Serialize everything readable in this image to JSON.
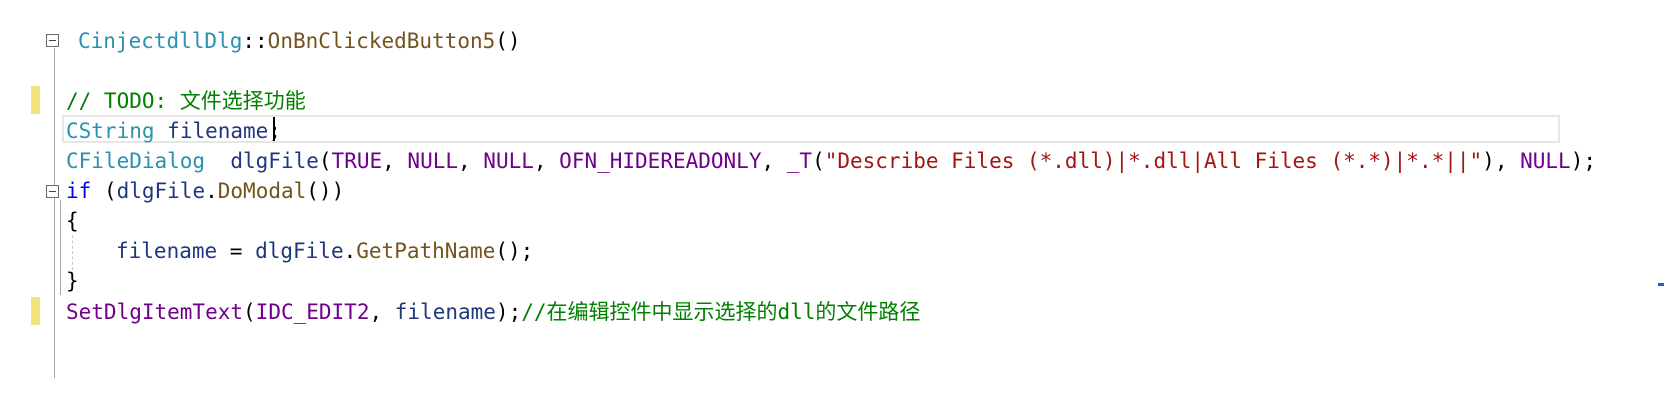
{
  "editor": {
    "lines": [
      {
        "id": "fn-signature",
        "tokens": [
          {
            "cls": "t",
            "text": "CinjectdllDlg"
          },
          {
            "cls": "p",
            "text": "::"
          },
          {
            "cls": "f",
            "text": "OnBnClickedButton5"
          },
          {
            "cls": "p",
            "text": "()"
          }
        ]
      },
      {
        "id": "todo-comment",
        "tokens": [
          {
            "cls": "c",
            "text": "// TODO: 文件选择功能"
          }
        ]
      },
      {
        "id": "filename-decl",
        "tokens": [
          {
            "cls": "t",
            "text": "CString"
          },
          {
            "cls": "p",
            "text": " "
          },
          {
            "cls": "v",
            "text": "filename"
          },
          {
            "cls": "p",
            "text": ";"
          }
        ]
      },
      {
        "id": "filedialog-decl",
        "tokens": [
          {
            "cls": "t",
            "text": "CFileDialog"
          },
          {
            "cls": "p",
            "text": "  "
          },
          {
            "cls": "v",
            "text": "dlgFile"
          },
          {
            "cls": "p",
            "text": "("
          },
          {
            "cls": "m",
            "text": "TRUE"
          },
          {
            "cls": "p",
            "text": ", "
          },
          {
            "cls": "m",
            "text": "NULL"
          },
          {
            "cls": "p",
            "text": ", "
          },
          {
            "cls": "m",
            "text": "NULL"
          },
          {
            "cls": "p",
            "text": ", "
          },
          {
            "cls": "m",
            "text": "OFN_HIDEREADONLY"
          },
          {
            "cls": "p",
            "text": ", "
          },
          {
            "cls": "m",
            "text": "_T"
          },
          {
            "cls": "p",
            "text": "("
          },
          {
            "cls": "s",
            "text": "\"Describe Files (*.dll)|*.dll|All Files (*.*)|*.*||\""
          },
          {
            "cls": "p",
            "text": "), "
          },
          {
            "cls": "m",
            "text": "NULL"
          },
          {
            "cls": "p",
            "text": ");"
          }
        ]
      },
      {
        "id": "if-statement",
        "tokens": [
          {
            "cls": "k",
            "text": "if"
          },
          {
            "cls": "p",
            "text": " ("
          },
          {
            "cls": "v",
            "text": "dlgFile"
          },
          {
            "cls": "p",
            "text": "."
          },
          {
            "cls": "f",
            "text": "DoModal"
          },
          {
            "cls": "p",
            "text": "())"
          }
        ]
      },
      {
        "id": "open-brace",
        "tokens": [
          {
            "cls": "p",
            "text": "{"
          }
        ]
      },
      {
        "id": "assign-path",
        "tokens": [
          {
            "cls": "v",
            "text": "filename"
          },
          {
            "cls": "p",
            "text": " = "
          },
          {
            "cls": "v",
            "text": "dlgFile"
          },
          {
            "cls": "p",
            "text": "."
          },
          {
            "cls": "f",
            "text": "GetPathName"
          },
          {
            "cls": "p",
            "text": "();"
          }
        ]
      },
      {
        "id": "close-brace",
        "tokens": [
          {
            "cls": "p",
            "text": "}"
          }
        ]
      },
      {
        "id": "set-item-text",
        "tokens": [
          {
            "cls": "m",
            "text": "SetDlgItemText"
          },
          {
            "cls": "p",
            "text": "("
          },
          {
            "cls": "m",
            "text": "IDC_EDIT2"
          },
          {
            "cls": "p",
            "text": ", "
          },
          {
            "cls": "v",
            "text": "filename"
          },
          {
            "cls": "p",
            "text": ");"
          },
          {
            "cls": "c",
            "text": "//在编辑控件中显示选择的dll的文件路径"
          }
        ]
      }
    ]
  },
  "colors": {
    "keyword": "#0000ff",
    "type": "#2b91af",
    "function": "#74531f",
    "macro": "#6f008a",
    "string": "#a31515",
    "comment": "#008000",
    "variable": "#1f377f",
    "change_marker": "#f3e27a"
  }
}
